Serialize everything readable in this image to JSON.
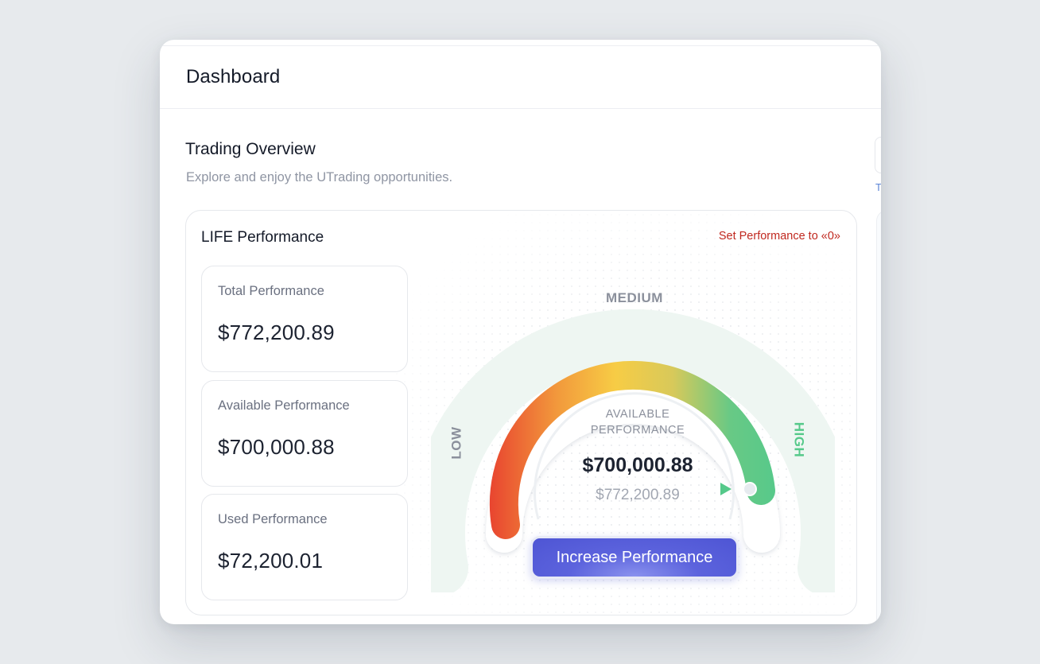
{
  "header": {
    "title": "Dashboard"
  },
  "overview": {
    "title": "Trading Overview",
    "subtitle": "Explore and enjoy the UTrading opportunities.",
    "peek_text": "T"
  },
  "performance_card": {
    "title": "LIFE Performance",
    "reset_link": "Set Performance to «0»",
    "stats": [
      {
        "label": "Total Performance",
        "value": "$772,200.89"
      },
      {
        "label": "Available Performance",
        "value": "$700,000.88"
      },
      {
        "label": "Used Performance",
        "value": "$72,200.01"
      }
    ],
    "gauge": {
      "label_low": "LOW",
      "label_medium": "MEDIUM",
      "label_high": "HIGH",
      "caption": "AVAILABLE PERFORMANCE",
      "value": "$700,000.88",
      "total": "$772,200.89",
      "level_fraction": 0.906,
      "colors": {
        "low": "#e8412f",
        "medium": "#f7cc45",
        "high": "#58c98a",
        "track": "#eef6f2"
      }
    },
    "increase_button": "Increase Performance"
  },
  "colors": {
    "accent": "#5259d8",
    "danger": "#c0281f",
    "background": "#e7eaed"
  }
}
